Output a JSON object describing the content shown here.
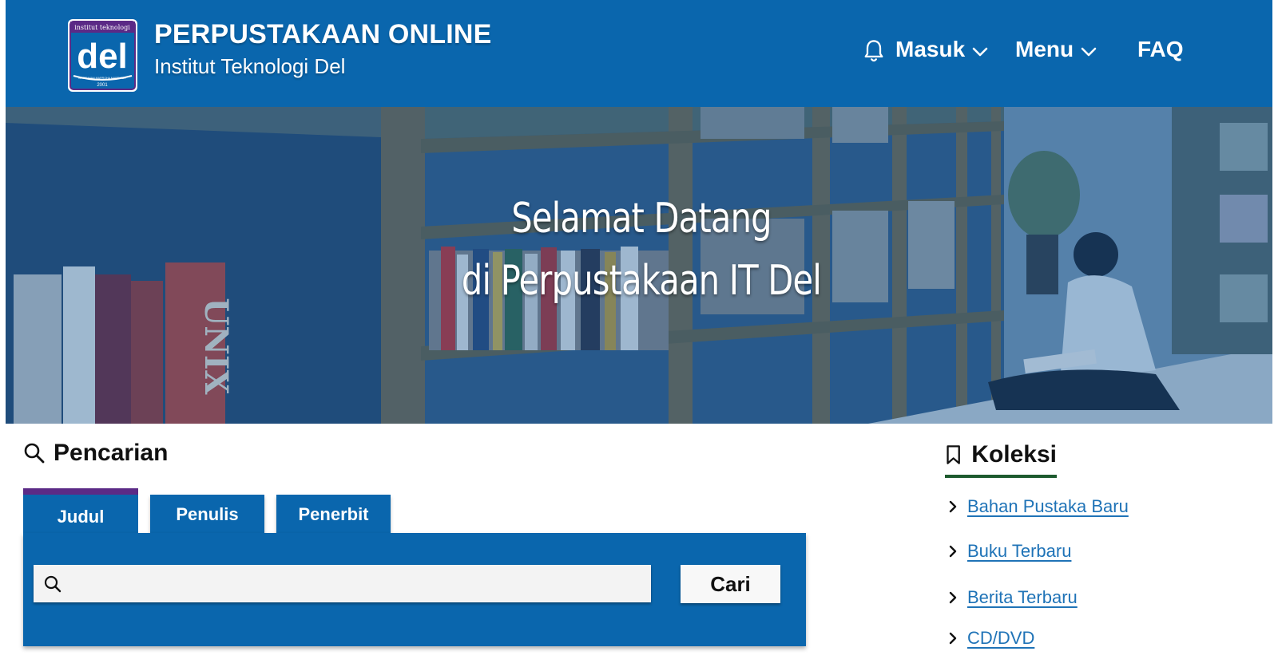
{
  "header": {
    "title": "PERPUSTAKAAN ONLINE",
    "subtitle": "Institut Teknologi Del",
    "logo": {
      "top_text": "institut teknologi",
      "main_text": "del",
      "bottom_text": "MARTUHAN MARROHA MARBISUK",
      "year": "2001"
    },
    "nav": {
      "bell_icon": "bell-icon",
      "login": "Masuk",
      "menu": "Menu",
      "faq": "FAQ"
    },
    "colors": {
      "bar": "#0a66ad"
    }
  },
  "hero": {
    "line1": "Selamat Datang",
    "line2": "di Perpustakaan IT Del",
    "spine_text": "UNIX"
  },
  "search": {
    "title": "Pencarian",
    "tabs": [
      "Judul",
      "Penulis",
      "Penerbit"
    ],
    "active_tab": "Judul",
    "input_value": "",
    "input_placeholder": "",
    "button": "Cari"
  },
  "koleksi": {
    "title": "Koleksi",
    "items": [
      "Bahan Pustaka Baru",
      "Buku Terbaru",
      "Berita Terbaru",
      "CD/DVD"
    ]
  }
}
